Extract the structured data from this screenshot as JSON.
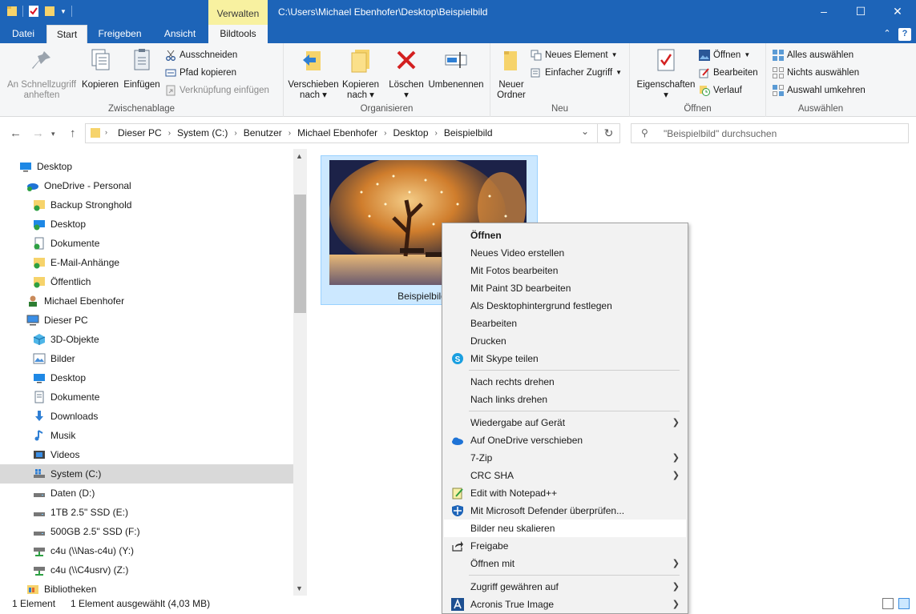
{
  "window": {
    "path_title": "C:\\Users\\Michael Ebenhofer\\Desktop\\Beispielbild",
    "context_tab": "Verwalten",
    "minimize": "–",
    "maximize": "☐",
    "close": "✕"
  },
  "tabs": {
    "datei": "Datei",
    "start": "Start",
    "freigeben": "Freigeben",
    "ansicht": "Ansicht",
    "bildtools": "Bildtools",
    "collapse": "⌃",
    "help": "?"
  },
  "ribbon": {
    "zwischenablage": {
      "label": "Zwischenablage",
      "pin": "An Schnellzugriff anheften",
      "copy": "Kopieren",
      "paste": "Einfügen",
      "cut": "Ausschneiden",
      "copy_path": "Pfad kopieren",
      "paste_shortcut": "Verknüpfung einfügen"
    },
    "organisieren": {
      "label": "Organisieren",
      "move": "Verschieben nach",
      "copyto": "Kopieren nach",
      "delete": "Löschen",
      "rename": "Umbenennen"
    },
    "neu": {
      "label": "Neu",
      "folder": "Neuer Ordner",
      "new_item": "Neues Element",
      "easy_access": "Einfacher Zugriff"
    },
    "oeffnen": {
      "label": "Öffnen",
      "properties": "Eigenschaften",
      "open": "Öffnen",
      "edit": "Bearbeiten",
      "history": "Verlauf"
    },
    "auswaehlen": {
      "label": "Auswählen",
      "all": "Alles auswählen",
      "none": "Nichts auswählen",
      "invert": "Auswahl umkehren"
    }
  },
  "address": {
    "crumbs": [
      "Dieser PC",
      "System (C:)",
      "Benutzer",
      "Michael Ebenhofer",
      "Desktop",
      "Beispielbild"
    ],
    "search_placeholder": "\"Beispielbild\" durchsuchen"
  },
  "tree": [
    {
      "label": "Desktop"
    },
    {
      "label": "OneDrive - Personal"
    },
    {
      "label": "Backup Stronghold"
    },
    {
      "label": "Desktop"
    },
    {
      "label": "Dokumente"
    },
    {
      "label": "E-Mail-Anhänge"
    },
    {
      "label": "Öffentlich"
    },
    {
      "label": "Michael Ebenhofer"
    },
    {
      "label": "Dieser PC"
    },
    {
      "label": "3D-Objekte"
    },
    {
      "label": "Bilder"
    },
    {
      "label": "Desktop"
    },
    {
      "label": "Dokumente"
    },
    {
      "label": "Downloads"
    },
    {
      "label": "Musik"
    },
    {
      "label": "Videos"
    },
    {
      "label": "System (C:)"
    },
    {
      "label": "Daten (D:)"
    },
    {
      "label": "1TB 2.5\" SSD (E:)"
    },
    {
      "label": "500GB 2.5\" SSD (F:)"
    },
    {
      "label": "c4u (\\\\Nas-c4u) (Y:)"
    },
    {
      "label": "c4u (\\\\C4usrv) (Z:)"
    },
    {
      "label": "Bibliotheken"
    }
  ],
  "file": {
    "label": "Beispielbild (ca"
  },
  "status": {
    "count": "1 Element",
    "selected": "1 Element ausgewählt (4,03 MB)"
  },
  "context_menu": [
    {
      "label": "Öffnen"
    },
    {
      "label": "Neues Video erstellen"
    },
    {
      "label": "Mit Fotos bearbeiten"
    },
    {
      "label": "Mit Paint 3D bearbeiten"
    },
    {
      "label": "Als Desktophintergrund festlegen"
    },
    {
      "label": "Bearbeiten"
    },
    {
      "label": "Drucken"
    },
    {
      "label": "Mit Skype teilen"
    },
    {
      "label": "Nach rechts drehen"
    },
    {
      "label": "Nach links drehen"
    },
    {
      "label": "Wiedergabe auf Gerät"
    },
    {
      "label": "Auf OneDrive verschieben"
    },
    {
      "label": "7-Zip"
    },
    {
      "label": "CRC SHA"
    },
    {
      "label": "Edit with Notepad++"
    },
    {
      "label": "Mit Microsoft Defender überprüfen..."
    },
    {
      "label": "Bilder neu skalieren"
    },
    {
      "label": "Freigabe"
    },
    {
      "label": "Öffnen mit"
    },
    {
      "label": "Zugriff gewähren auf"
    },
    {
      "label": "Acronis True Image"
    }
  ],
  "colors": {
    "accent": "#1d64b8",
    "selection": "#cce8ff",
    "context_tab": "#f8f1a0"
  }
}
